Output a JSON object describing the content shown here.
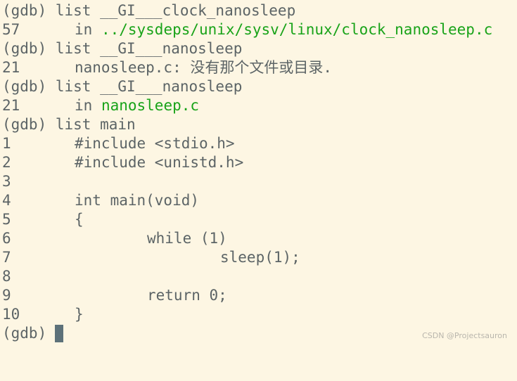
{
  "terminal": {
    "prompt": "(gdb)",
    "lines": [
      {
        "type": "command",
        "text": "(gdb) list __GI___clock_nanosleep"
      },
      {
        "type": "output",
        "no": "57",
        "prefix": "in ",
        "path": "../sysdeps/unix/sysv/linux/clock_nanosleep.c"
      },
      {
        "type": "command",
        "text": "(gdb) list __GI___nanosleep"
      },
      {
        "type": "output",
        "no": "21",
        "text": "nanosleep.c: 没有那个文件或目录."
      },
      {
        "type": "command",
        "text": "(gdb) list __GI___nanosleep"
      },
      {
        "type": "output",
        "no": "21",
        "prefix": "in ",
        "path": "nanosleep.c"
      },
      {
        "type": "command",
        "text": "(gdb) list main"
      }
    ],
    "source": [
      {
        "no": "1",
        "text": "#include <stdio.h>",
        "indent": 1
      },
      {
        "no": "2",
        "text": "#include <unistd.h>",
        "indent": 1
      },
      {
        "no": "3",
        "text": "",
        "indent": 1
      },
      {
        "no": "4",
        "text": "int main(void)",
        "indent": 1
      },
      {
        "no": "5",
        "text": "{",
        "indent": 1
      },
      {
        "no": "6",
        "text": "while (1)",
        "indent": 2
      },
      {
        "no": "7",
        "text": "sleep(1);",
        "indent": 3
      },
      {
        "no": "8",
        "text": "",
        "indent": 1
      },
      {
        "no": "9",
        "text": "return 0;",
        "indent": 2
      },
      {
        "no": "10",
        "text": "}",
        "indent": 1
      }
    ]
  },
  "colors": {
    "background": "#fdf6e3",
    "text": "#5c6466",
    "path": "#19a319",
    "cursor": "#5d7179"
  },
  "watermark": "CSDN @Projectsauron"
}
